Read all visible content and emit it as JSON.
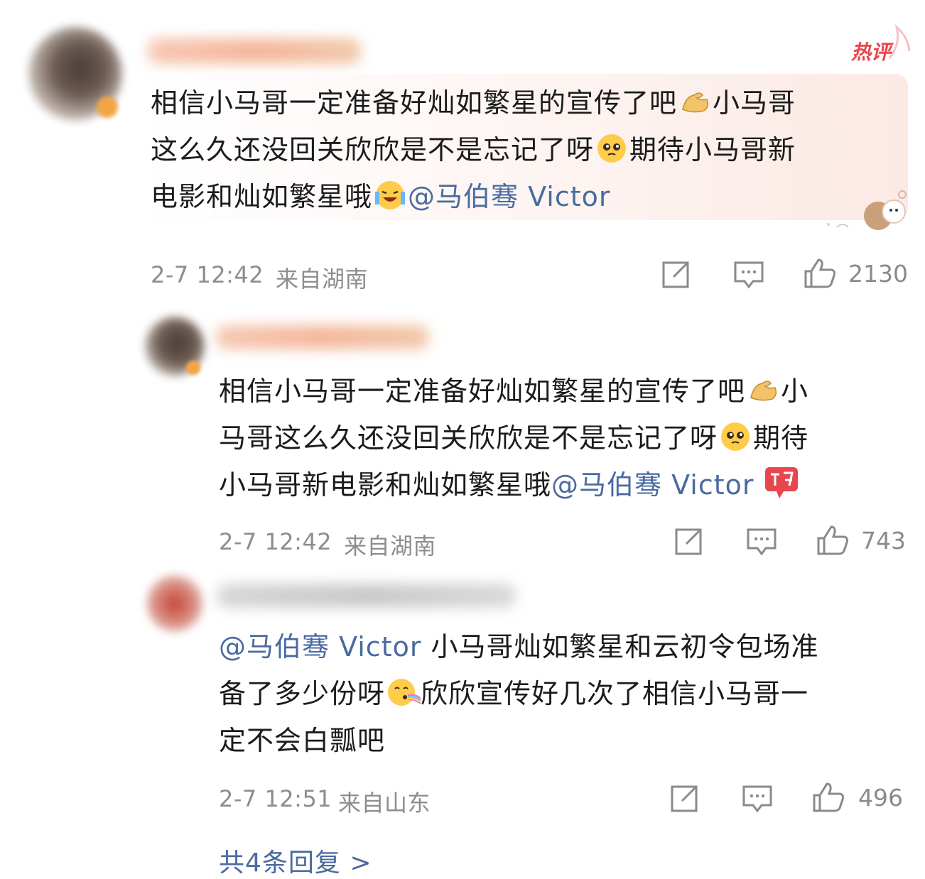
{
  "comments": [
    {
      "text_parts": [
        "相信小马哥一定准备好灿如繁星的宣传了吧",
        "小马哥",
        "这么久还没回关欣欣是不是忘记了呀",
        "期待小马哥新",
        "电影和灿如繁星哦"
      ],
      "mention": "@马伯骞 Victor",
      "hot_badge": "热评",
      "time": "2-7 12:42",
      "location": "来自湖南",
      "likes": "2130",
      "emojis": [
        "flexed-biceps-icon",
        "pleading-face-icon",
        "crying-laughing-icon"
      ]
    },
    {
      "text_parts": [
        "相信小马哥一定准备好灿如繁星的宣传了吧",
        "小",
        "马哥这么久还没回关欣欣是不是忘记了呀",
        "期待",
        "小马哥新电影和灿如繁星哦"
      ],
      "mention": "@马伯骞 Victor",
      "time": "2-7 12:42",
      "location": "来自湖南",
      "likes": "743",
      "emojis": [
        "flexed-biceps-icon",
        "pleading-face-icon",
        "go-badge-icon"
      ]
    },
    {
      "mention": "@马伯骞 Victor",
      "text_parts": [
        " 小马哥灿如繁星和云初令包场准",
        "备了多少份呀",
        "欣欣宣传好几次了相信小马哥一",
        "定不会白瓢吧"
      ],
      "time": "2-7 12:51",
      "location": "来自山东",
      "likes": "496",
      "emojis": [
        "rainbow-kiss-face-icon"
      ]
    }
  ],
  "replies_link": "共4条回复 >",
  "colors": {
    "mention": "#4a6aa0",
    "meta": "#8d8d8d",
    "hot_badge": "#e8464e",
    "highlight_bg": "#fdf1ee"
  }
}
